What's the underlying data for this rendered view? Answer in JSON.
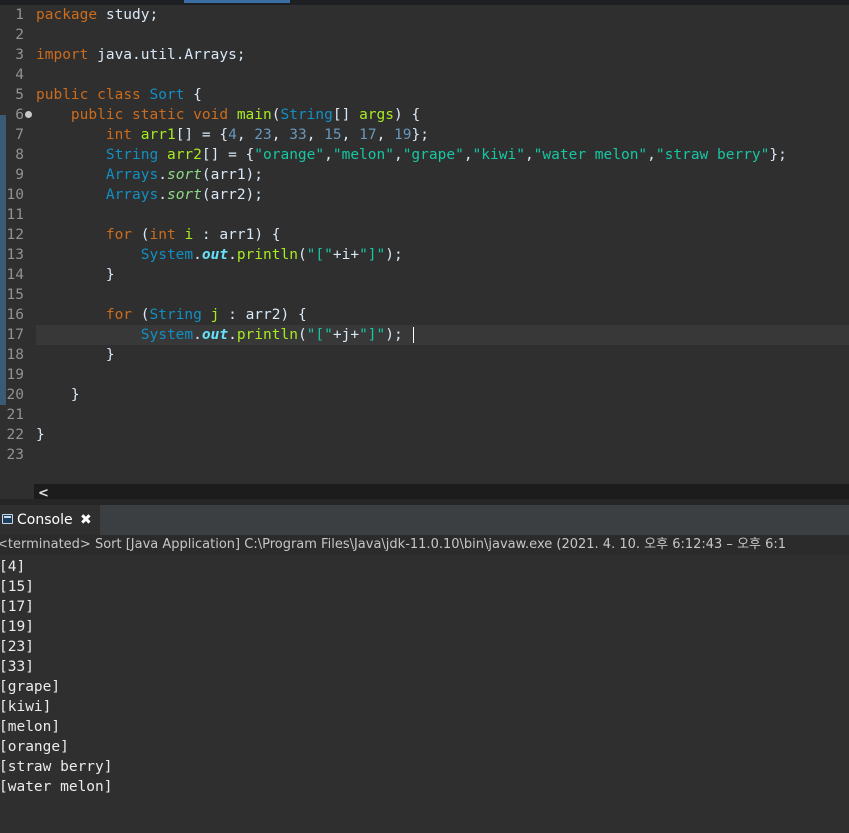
{
  "editor": {
    "line_numbers": [
      "1",
      "2",
      "3",
      "4",
      "5",
      "6",
      "7",
      "8",
      "9",
      "10",
      "11",
      "12",
      "13",
      "14",
      "15",
      "16",
      "17",
      "18",
      "19",
      "20",
      "21",
      "22",
      "23"
    ],
    "tokens": {
      "package_kw": "package",
      "package_name": " study;",
      "import_kw": "import",
      "import_name": " java.util.Arrays;",
      "public": "public",
      "class": "class",
      "class_name": "Sort",
      "brace_open": " {",
      "static": "static",
      "void": "void",
      "main": "main",
      "String": "String",
      "args": "args",
      "int": "int",
      "arr1": "arr1",
      "arr2": "arr2",
      "Arrays": "Arrays",
      "sort": "sort",
      "for": "for",
      "i": "i",
      "j": "j",
      "System": "System",
      "out": "out",
      "println": "println",
      "nums": [
        "4",
        "23",
        "33",
        "15",
        "17",
        "19"
      ],
      "strs": [
        "\"orange\"",
        "\"melon\"",
        "\"grape\"",
        "\"kiwi\"",
        "\"water melon\"",
        "\"straw berry\""
      ],
      "open_bracket_str": "\"[\"",
      "close_bracket_str": "\"]\""
    },
    "scroll_arrow": "<"
  },
  "console": {
    "tab_label": "Console",
    "close_glyph": "✖",
    "status_text": "<terminated> Sort [Java Application] C:\\Program Files\\Java\\jdk-11.0.10\\bin\\javaw.exe  (2021. 4. 10. 오후 6:12:43 – 오후 6:1",
    "output": [
      "[4]",
      "[15]",
      "[17]",
      "[19]",
      "[23]",
      "[33]",
      "[grape]",
      "[kiwi]",
      "[melon]",
      "[orange]",
      "[straw berry]",
      "[water melon]"
    ]
  },
  "colors": {
    "keyword": "#cc6c1d",
    "type": "#1290c3",
    "method": "#a7ec21",
    "string": "#17c6a3",
    "number": "#6897bb",
    "background": "#2f2f2f"
  }
}
